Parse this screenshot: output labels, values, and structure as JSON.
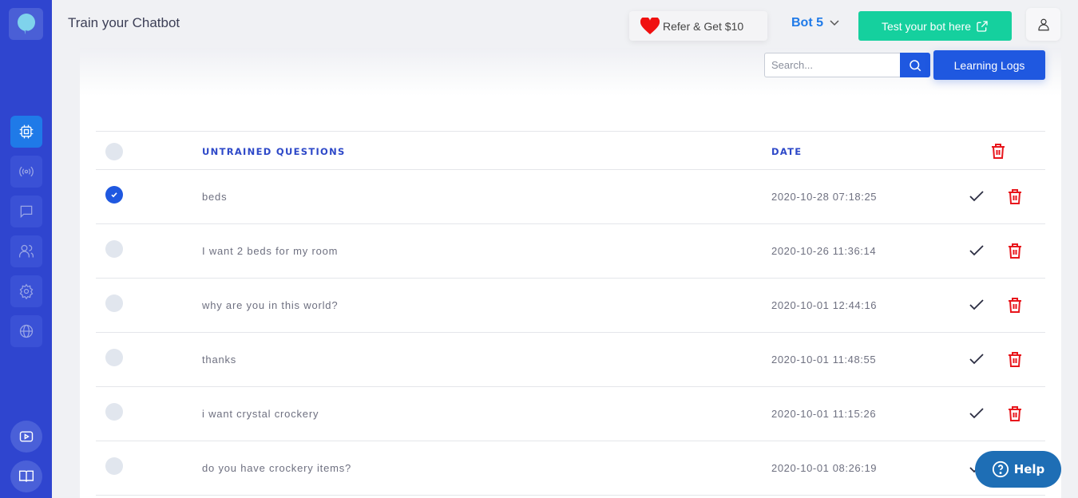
{
  "header": {
    "title": "Train your Chatbot",
    "refer_label": "Refer & Get $10",
    "bot_selector": "Bot 5",
    "test_bot_label": "Test your bot here"
  },
  "sidebar": {
    "items": [
      {
        "name": "train",
        "icon": "cpu-icon",
        "active": true
      },
      {
        "name": "broadcast",
        "icon": "broadcast-icon",
        "active": false
      },
      {
        "name": "chat",
        "icon": "chat-icon",
        "active": false
      },
      {
        "name": "users",
        "icon": "users-icon",
        "active": false
      },
      {
        "name": "settings",
        "icon": "gear-icon",
        "active": false
      },
      {
        "name": "web",
        "icon": "globe-icon",
        "active": false
      }
    ],
    "bottom": [
      {
        "name": "video-tutorials",
        "icon": "video-icon"
      },
      {
        "name": "docs",
        "icon": "book-icon"
      }
    ]
  },
  "toolbar": {
    "search_placeholder": "Search...",
    "search_value": "",
    "learning_logs_label": "Learning Logs"
  },
  "table": {
    "columns": {
      "question": "UNTRAINED QUESTIONS",
      "date": "DATE"
    },
    "rows": [
      {
        "question": "beds",
        "date": "2020-10-28 07:18:25",
        "selected": true
      },
      {
        "question": "I want 2 beds for my room",
        "date": "2020-10-26 11:36:14",
        "selected": false
      },
      {
        "question": "why are you in this world?",
        "date": "2020-10-01 12:44:16",
        "selected": false
      },
      {
        "question": "thanks",
        "date": "2020-10-01 11:48:55",
        "selected": false
      },
      {
        "question": "i want crystal crockery",
        "date": "2020-10-01 11:15:26",
        "selected": false
      },
      {
        "question": "do you have crockery items?",
        "date": "2020-10-01 08:26:19",
        "selected": false
      }
    ]
  },
  "help": {
    "label": "Help"
  },
  "colors": {
    "sidebar": "#2f45cf",
    "active_nav": "#1f7ae8",
    "primary": "#1f58e0",
    "success": "#15d09e",
    "danger": "#e8161c",
    "help": "#1e6eb5"
  }
}
